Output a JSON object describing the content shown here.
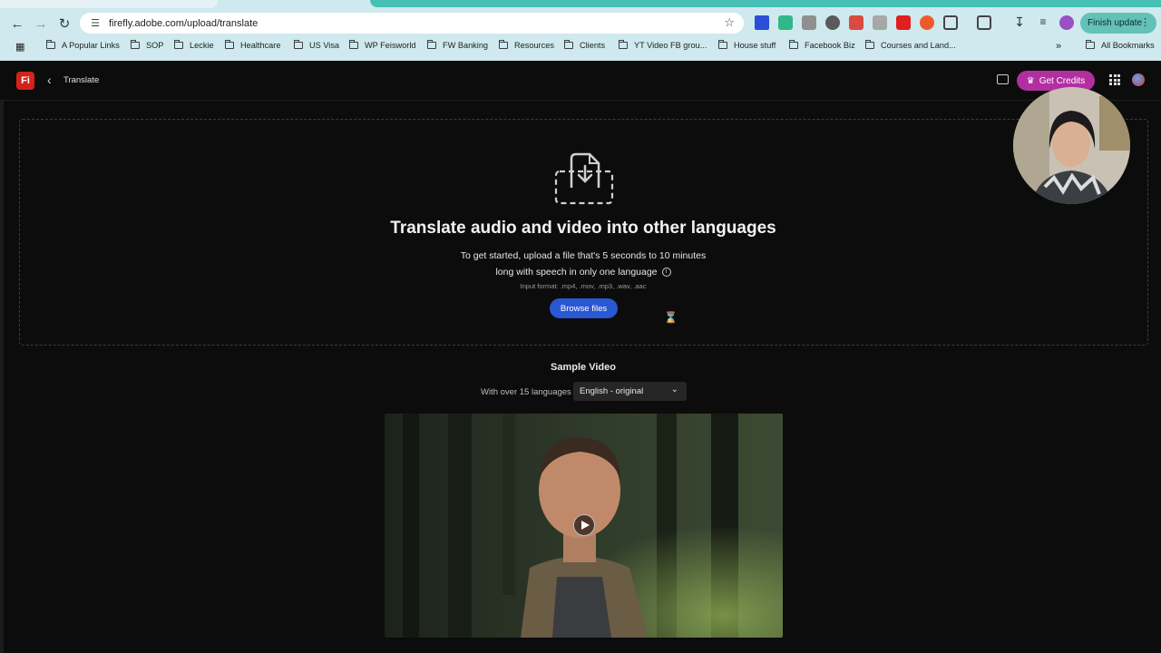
{
  "browser": {
    "url": "firefly.adobe.com/upload/translate",
    "finish_update": "Finish update",
    "bookmarks": [
      "A Popular Links",
      "SOP",
      "Leckie",
      "Healthcare",
      "US Visa",
      "WP Feisworld",
      "FW Banking",
      "Resources",
      "Clients",
      "YT Video FB grou...",
      "House stuff",
      "Facebook Biz",
      "Courses and Land..."
    ],
    "all_bookmarks": "All Bookmarks"
  },
  "app": {
    "logo": "Fi",
    "breadcrumb": "Translate",
    "credits_label": "Get Credits",
    "accent": "#b22fa0"
  },
  "upload": {
    "title": "Translate audio and video into other languages",
    "desc_line1": "To get started, upload a file that's 5 seconds to 10 minutes",
    "desc_line2": "long with speech in only one language",
    "formats": "Input format: .mp4, .mov, .mp3, .wav, .aac",
    "browse_label": "Browse files",
    "browse_color": "#2a57d4"
  },
  "sample": {
    "title": "Sample Video",
    "lang_label": "With over 15 languages",
    "lang_selected": "English - original"
  }
}
